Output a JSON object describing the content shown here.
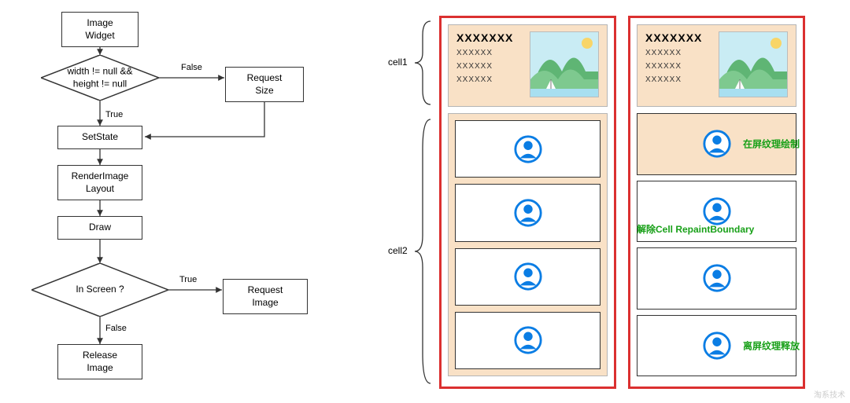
{
  "flowchart": {
    "nodes": {
      "image_widget": "Image Widget",
      "cond1_line1": "width != null &&",
      "cond1_line2": "height != null",
      "request_size": "Request Size",
      "set_state": "SetState",
      "render_layout_line1": "RenderImage",
      "render_layout_line2": "Layout",
      "draw": "Draw",
      "cond2": "In Screen ?",
      "request_image": "Request Image",
      "release_image": "Release Image"
    },
    "labels": {
      "false1": "False",
      "true1": "True",
      "true2": "True",
      "false2": "False"
    }
  },
  "cells": {
    "brace1": "cell1",
    "brace2": "cell2",
    "title": "XXXXXXX",
    "line": "XXXXXX",
    "annotations": {
      "on_screen_draw": "在屏纹理绘制",
      "remove_repaint": "解除Cell RepaintBoundary",
      "off_screen_release": "离屏纹理释放"
    }
  },
  "watermark": "淘系技术"
}
